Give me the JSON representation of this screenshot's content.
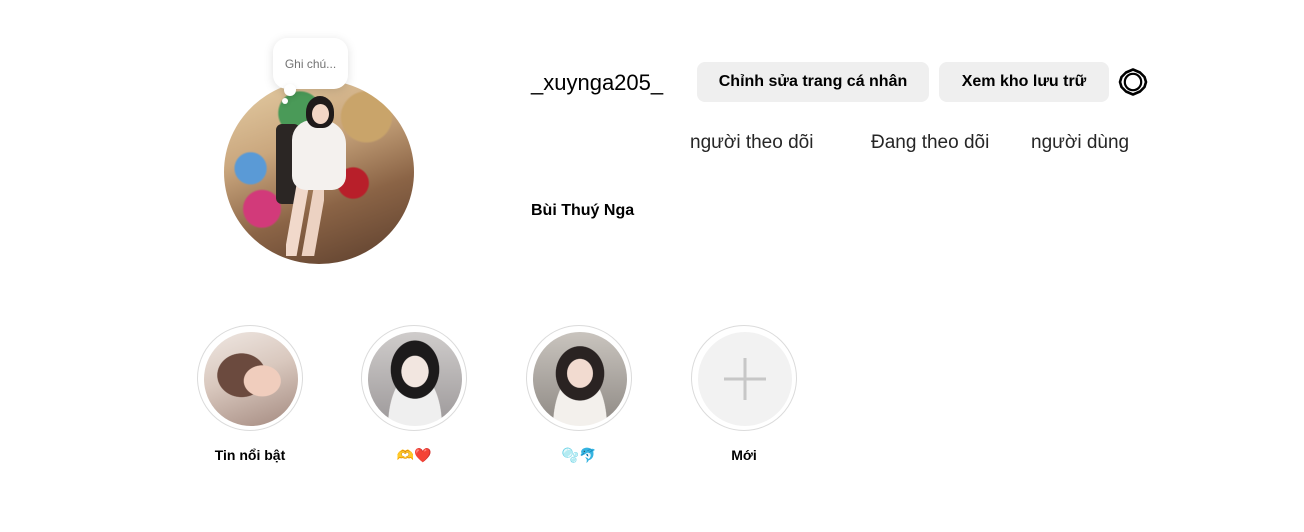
{
  "profile": {
    "note_placeholder": "Ghi chú...",
    "username": "_xuynga205_",
    "full_name": "Bùi Thuý Nga"
  },
  "actions": {
    "edit_profile_label": "Chỉnh sửa trang cá nhân",
    "view_archive_label": "Xem kho lưu trữ",
    "settings_icon": "gear-icon"
  },
  "stats": {
    "followers_label": "người theo dõi",
    "following_label": "Đang theo dõi",
    "users_label": "người dùng"
  },
  "highlights": [
    {
      "label": "Tin nổi bật"
    },
    {
      "label": "🫶❤️"
    },
    {
      "label": "🫧🐬"
    },
    {
      "label": "Mới",
      "icon": "plus-icon"
    }
  ],
  "colors": {
    "button_bg": "#efefef",
    "ring_border": "#dbdbdb",
    "muted_text": "#737373"
  }
}
